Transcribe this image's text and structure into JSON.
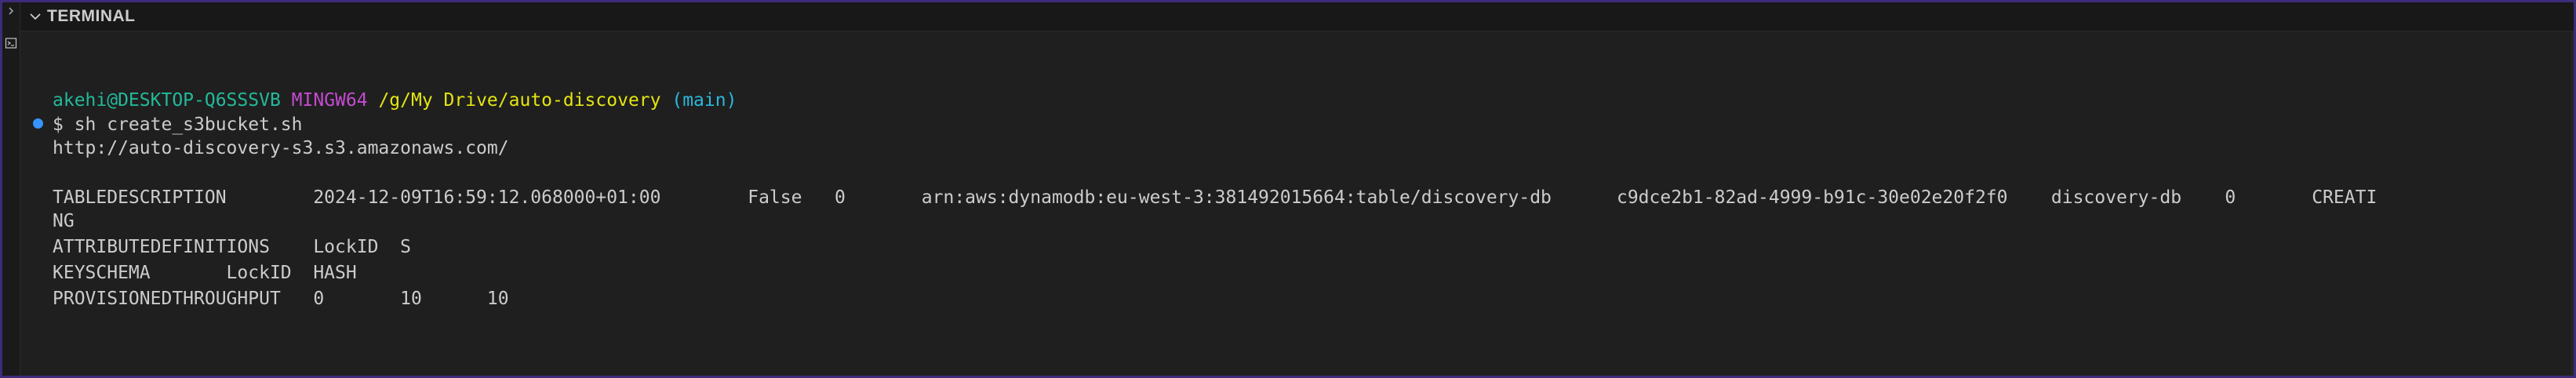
{
  "panel": {
    "title": "TERMINAL"
  },
  "icons": {
    "panel_chevron": "chevron-down-icon",
    "activity_chevron": "chevron-right-icon",
    "terminal_icon": "terminal-icon",
    "command_status": "command-decoration-dot"
  },
  "colors": {
    "background": "#1f1f1f",
    "header": "#181818",
    "frame_border": "#3c2c7a",
    "prompt_user": "#23b99a",
    "prompt_env": "#c44ad1",
    "prompt_path": "#e5e510",
    "prompt_branch": "#29b8db",
    "text": "#cccccc",
    "decoration": "#3794ff"
  },
  "terminal": {
    "prompt": {
      "user_host": "akehi@DESKTOP-Q6SSSVB",
      "environment": "MINGW64",
      "path": "/g/My Drive/auto-discovery",
      "branch": "(main)"
    },
    "command": "$ sh create_s3bucket.sh",
    "output": [
      "http://auto-discovery-s3.s3.amazonaws.com/",
      "",
      "TABLEDESCRIPTION        2024-12-09T16:59:12.068000+01:00        False   0       arn:aws:dynamodb:eu-west-3:381492015664:table/discovery-db      c9dce2b1-82ad-4999-b91c-30e02e20f2f0    discovery-db    0       CREATI",
      "NG",
      "ATTRIBUTEDEFINITIONS    LockID  S",
      "KEYSCHEMA       LockID  HASH",
      "PROVISIONEDTHROUGHPUT   0       10      10"
    ]
  }
}
